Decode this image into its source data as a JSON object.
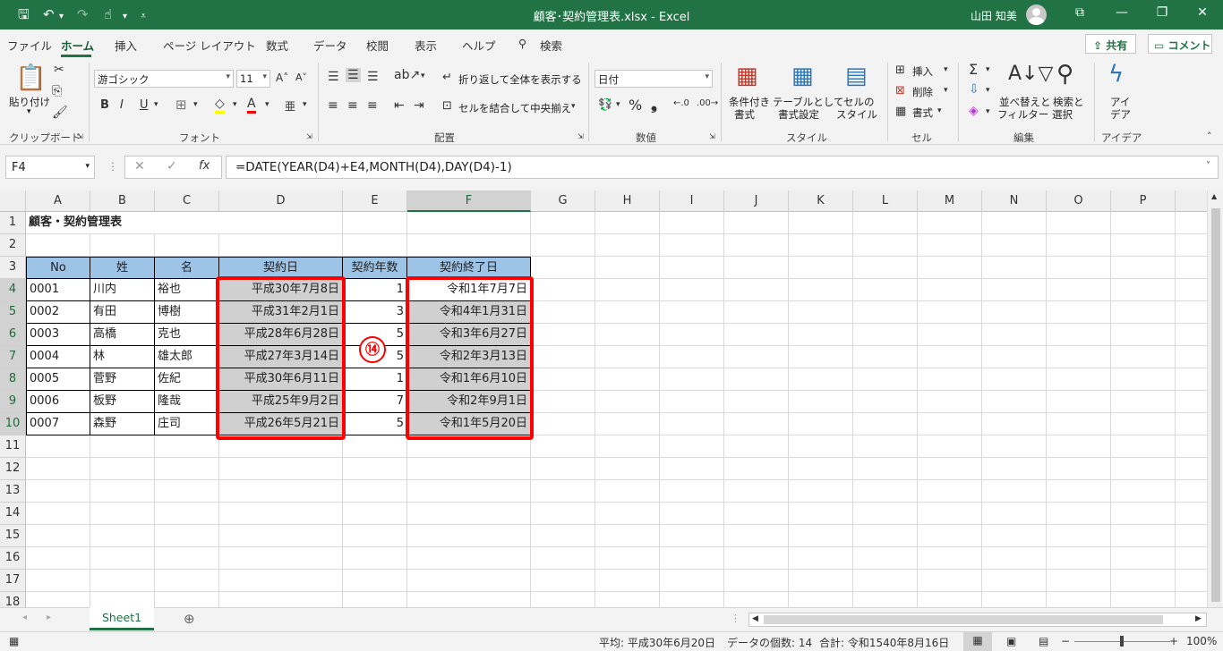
{
  "window": {
    "title": "顧客･契約管理表.xlsx  -  Excel",
    "user": "山田 知美"
  },
  "tabs": [
    "ファイル",
    "ホーム",
    "挿入",
    "ページ レイアウト",
    "数式",
    "データ",
    "校閲",
    "表示",
    "ヘルプ",
    "検索"
  ],
  "share_label": "共有",
  "comment_label": "コメント",
  "ribbon": {
    "clipboard": {
      "paste": "貼り付け",
      "label": "クリップボード"
    },
    "font": {
      "name": "游ゴシック",
      "size": "11",
      "label": "フォント"
    },
    "alignment": {
      "wrap": "折り返して全体を表示する",
      "merge": "セルを結合して中央揃え",
      "label": "配置"
    },
    "number": {
      "format": "日付",
      "label": "数値"
    },
    "styles": {
      "conditional": "条件付き",
      "conditional2": "書式",
      "table": "テーブルとして",
      "table2": "書式設定",
      "cell": "セルの",
      "cell2": "スタイル",
      "label": "スタイル"
    },
    "cells": {
      "insert": "挿入",
      "delete": "削除",
      "format": "書式",
      "label": "セル"
    },
    "editing": {
      "sort": "並べ替えと",
      "sort2": "フィルター",
      "find": "検索と",
      "find2": "選択",
      "label": "編集"
    },
    "ideas": {
      "l1": "アイ",
      "l2": "デア",
      "label": "アイデア"
    }
  },
  "formula_bar": {
    "name_box": "F4",
    "formula": "=DATE(YEAR(D4)+E4,MONTH(D4),DAY(D4)-1)"
  },
  "columns": [
    "A",
    "B",
    "C",
    "D",
    "E",
    "F",
    "G",
    "H",
    "I",
    "J",
    "K",
    "L",
    "M",
    "N",
    "O",
    "P"
  ],
  "rows": [
    "1",
    "2",
    "3",
    "4",
    "5",
    "6",
    "7",
    "8",
    "9",
    "10",
    "11",
    "12",
    "13",
    "14",
    "15",
    "16",
    "17",
    "18"
  ],
  "sheet": {
    "title": "顧客・契約管理表",
    "headers": [
      "No",
      "姓",
      "名",
      "契約日",
      "契約年数",
      "契約終了日"
    ],
    "records": [
      [
        "0001",
        "川内",
        "裕也",
        "平成30年7月8日",
        "1",
        "令和1年7月7日"
      ],
      [
        "0002",
        "有田",
        "博樹",
        "平成31年2月1日",
        "3",
        "令和4年1月31日"
      ],
      [
        "0003",
        "高橋",
        "克也",
        "平成28年6月28日",
        "5",
        "令和3年6月27日"
      ],
      [
        "0004",
        "林",
        "雄太郎",
        "平成27年3月14日",
        "5",
        "令和2年3月13日"
      ],
      [
        "0005",
        "菅野",
        "佐紀",
        "平成30年6月11日",
        "1",
        "令和1年6月10日"
      ],
      [
        "0006",
        "板野",
        "隆哉",
        "平成25年9月2日",
        "7",
        "令和2年9月1日"
      ],
      [
        "0007",
        "森野",
        "庄司",
        "平成26年5月21日",
        "5",
        "令和1年5月20日"
      ]
    ]
  },
  "annotation": "⑭",
  "sheet_tab": "Sheet1",
  "status": {
    "average": "平均:  平成30年6月20日",
    "count": "データの個数:  14",
    "sum": "合計:  令和1540年8月16日",
    "zoom": "100%"
  },
  "colors": {
    "accent": "#217346",
    "header_fill": "#9dc3e6",
    "highlight": "#ff0000"
  }
}
